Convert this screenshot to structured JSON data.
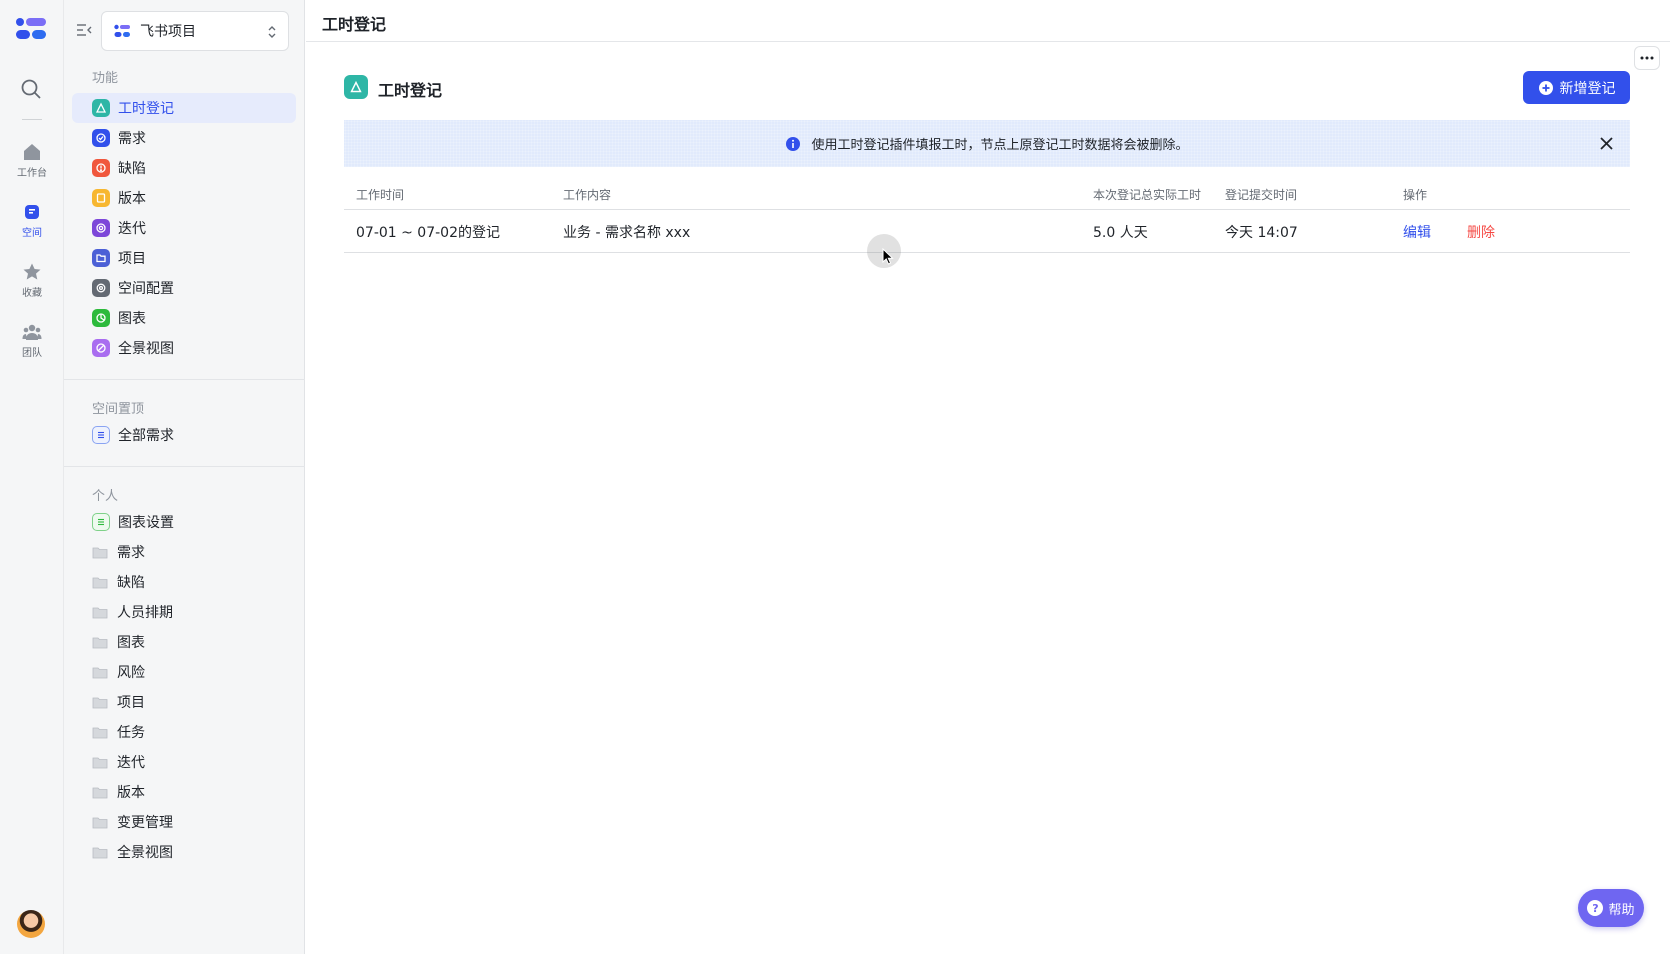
{
  "rail": {
    "items": [
      {
        "label": "工作台",
        "icon": "home-icon"
      },
      {
        "label": "空间",
        "icon": "space-icon"
      },
      {
        "label": "收藏",
        "icon": "star-icon"
      },
      {
        "label": "团队",
        "icon": "team-icon"
      }
    ]
  },
  "sidebar": {
    "space_name": "飞书项目",
    "sections": {
      "features": "功能",
      "pinned": "空间置顶",
      "personal": "个人"
    },
    "feature_items": [
      {
        "label": "工时登记",
        "icon": "timesheet-icon",
        "color": "#2eb6a6"
      },
      {
        "label": "需求",
        "icon": "requirement-icon",
        "color": "#3250eb"
      },
      {
        "label": "缺陷",
        "icon": "defect-icon",
        "color": "#f0573d"
      },
      {
        "label": "版本",
        "icon": "version-icon",
        "color": "#f7b731"
      },
      {
        "label": "迭代",
        "icon": "iteration-icon",
        "color": "#7d47d9"
      },
      {
        "label": "项目",
        "icon": "project-icon",
        "color": "#4c60d6"
      },
      {
        "label": "空间配置",
        "icon": "config-icon",
        "color": "#646a73"
      },
      {
        "label": "图表",
        "icon": "chart-icon",
        "color": "#2dba3c"
      },
      {
        "label": "全景视图",
        "icon": "panorama-icon",
        "color": "#a96df0"
      }
    ],
    "pinned_items": [
      {
        "label": "全部需求",
        "icon": "list-icon"
      }
    ],
    "personal_items": [
      {
        "label": "图表设置",
        "icon": "list-icon"
      },
      {
        "label": "需求",
        "icon": "folder-icon"
      },
      {
        "label": "缺陷",
        "icon": "folder-icon"
      },
      {
        "label": "人员排期",
        "icon": "folder-icon"
      },
      {
        "label": "图表",
        "icon": "folder-icon"
      },
      {
        "label": "风险",
        "icon": "folder-icon"
      },
      {
        "label": "项目",
        "icon": "folder-icon"
      },
      {
        "label": "任务",
        "icon": "folder-icon"
      },
      {
        "label": "迭代",
        "icon": "folder-icon"
      },
      {
        "label": "版本",
        "icon": "folder-icon"
      },
      {
        "label": "变更管理",
        "icon": "folder-icon"
      },
      {
        "label": "全景视图",
        "icon": "folder-icon"
      }
    ]
  },
  "header": {
    "title": "工时登记"
  },
  "panel": {
    "title": "工时登记",
    "add_button": "新增登记",
    "notice": "使用工时登记插件填报工时，节点上原登记工时数据将会被删除。"
  },
  "table": {
    "columns": [
      "工作时间",
      "工作内容",
      "本次登记总实际工时",
      "登记提交时间",
      "操作"
    ],
    "rows": [
      {
        "work_time": "07-01 ~ 07-02的登记",
        "content": "业务 - 需求名称 xxx",
        "hours": "5.0 人天",
        "submitted": "今天 14:07",
        "edit": "编辑",
        "delete": "删除"
      }
    ]
  },
  "help": {
    "label": "帮助"
  },
  "colors": {
    "accent": "#3250eb",
    "danger": "#f54a45",
    "help": "#6f66f1"
  }
}
